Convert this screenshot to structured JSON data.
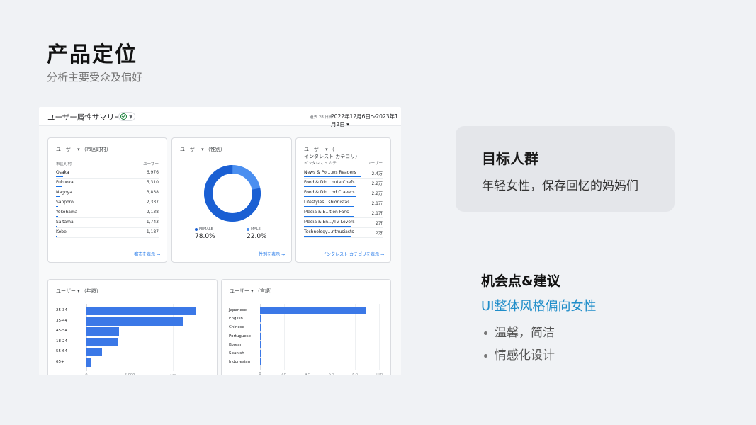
{
  "slide": {
    "title": "产品定位",
    "subtitle": "分析主要受众及偏好"
  },
  "panel": {
    "title": "ユーザー属性サマリー",
    "range_label": "過去 28 日間",
    "date_range": "2022年12月6日〜2023年1月2日 ▾"
  },
  "city_card": {
    "title": "ユーザー ▾ （市区町村）",
    "col_label": "市区町村",
    "col_value": "ユーザー",
    "rows": [
      {
        "label": "Osaka",
        "value": "6,976"
      },
      {
        "label": "Fukuoka",
        "value": "5,310"
      },
      {
        "label": "Nagoya",
        "value": "3,838"
      },
      {
        "label": "Sapporo",
        "value": "2,337"
      },
      {
        "label": "Yokohama",
        "value": "2,138"
      },
      {
        "label": "Saitama",
        "value": "1,743"
      },
      {
        "label": "Kobe",
        "value": "1,187"
      }
    ],
    "link": "都市を表示 →"
  },
  "gender_card": {
    "title": "ユーザー ▾ （性別）",
    "female_label": "FEMALE",
    "female_value": "78.0%",
    "male_label": "MALE",
    "male_value": "22.0%",
    "female_share": 0.78,
    "colors": {
      "female": "#1a5fd3",
      "male": "#4b8ff0"
    },
    "link": "性別を表示 →"
  },
  "interest_card": {
    "title_line1": "ユーザー ▾ （",
    "title_line2": "インタレスト カテゴリ）",
    "col_label": "インタレスト カテ…",
    "col_value": "ユーザー",
    "rows": [
      {
        "label": "News & Pol…ws Readers",
        "value": "2.4万"
      },
      {
        "label": "Food & Din…nute Chefs",
        "value": "2.2万"
      },
      {
        "label": "Food & Din…od Cravers",
        "value": "2.2万"
      },
      {
        "label": "Lifestyles…shionistas",
        "value": "2.1万"
      },
      {
        "label": "Media & E…tion Fans",
        "value": "2.1万"
      },
      {
        "label": "Media & En…/TV Lovers",
        "value": "2万"
      },
      {
        "label": "Technology…nthusiasts",
        "value": "2万"
      }
    ],
    "link": "インタレスト カテゴリを表示 →"
  },
  "age_card": {
    "title": "ユーザー ▾ （年齢）"
  },
  "lang_card": {
    "title": "ユーザー ▾ （言語）"
  },
  "chart_data": [
    {
      "type": "bar",
      "orientation": "horizontal",
      "categories": [
        "25-34",
        "35-44",
        "45-54",
        "18-24",
        "55-64",
        "65+"
      ],
      "values": [
        12600,
        11100,
        3800,
        3600,
        1800,
        550
      ],
      "xlim": [
        0,
        12600
      ],
      "x_ticks": [
        {
          "v": 0,
          "t": "0"
        },
        {
          "v": 5000,
          "t": "5,000"
        },
        {
          "v": 10000,
          "t": "1万"
        }
      ]
    },
    {
      "type": "bar",
      "orientation": "horizontal",
      "categories": [
        "Japanese",
        "English",
        "Chinese",
        "Portuguese",
        "Korean",
        "Spanish",
        "Indonesian"
      ],
      "values": [
        89000,
        300,
        50,
        30,
        30,
        20,
        10
      ],
      "xlim": [
        0,
        100000
      ],
      "x_ticks": [
        {
          "v": 0,
          "t": "0"
        },
        {
          "v": 20000,
          "t": "2万"
        },
        {
          "v": 40000,
          "t": "4万"
        },
        {
          "v": 60000,
          "t": "6万"
        },
        {
          "v": 80000,
          "t": "8万"
        },
        {
          "v": 100000,
          "t": "10万"
        }
      ]
    }
  ],
  "target": {
    "title": "目标人群",
    "text": "年轻女性，保存回忆的妈妈们"
  },
  "opportunity": {
    "title": "机会点&建议",
    "subtitle": "UI整体风格偏向女性",
    "bullets": [
      "温馨，简洁",
      "情感化设计"
    ]
  }
}
